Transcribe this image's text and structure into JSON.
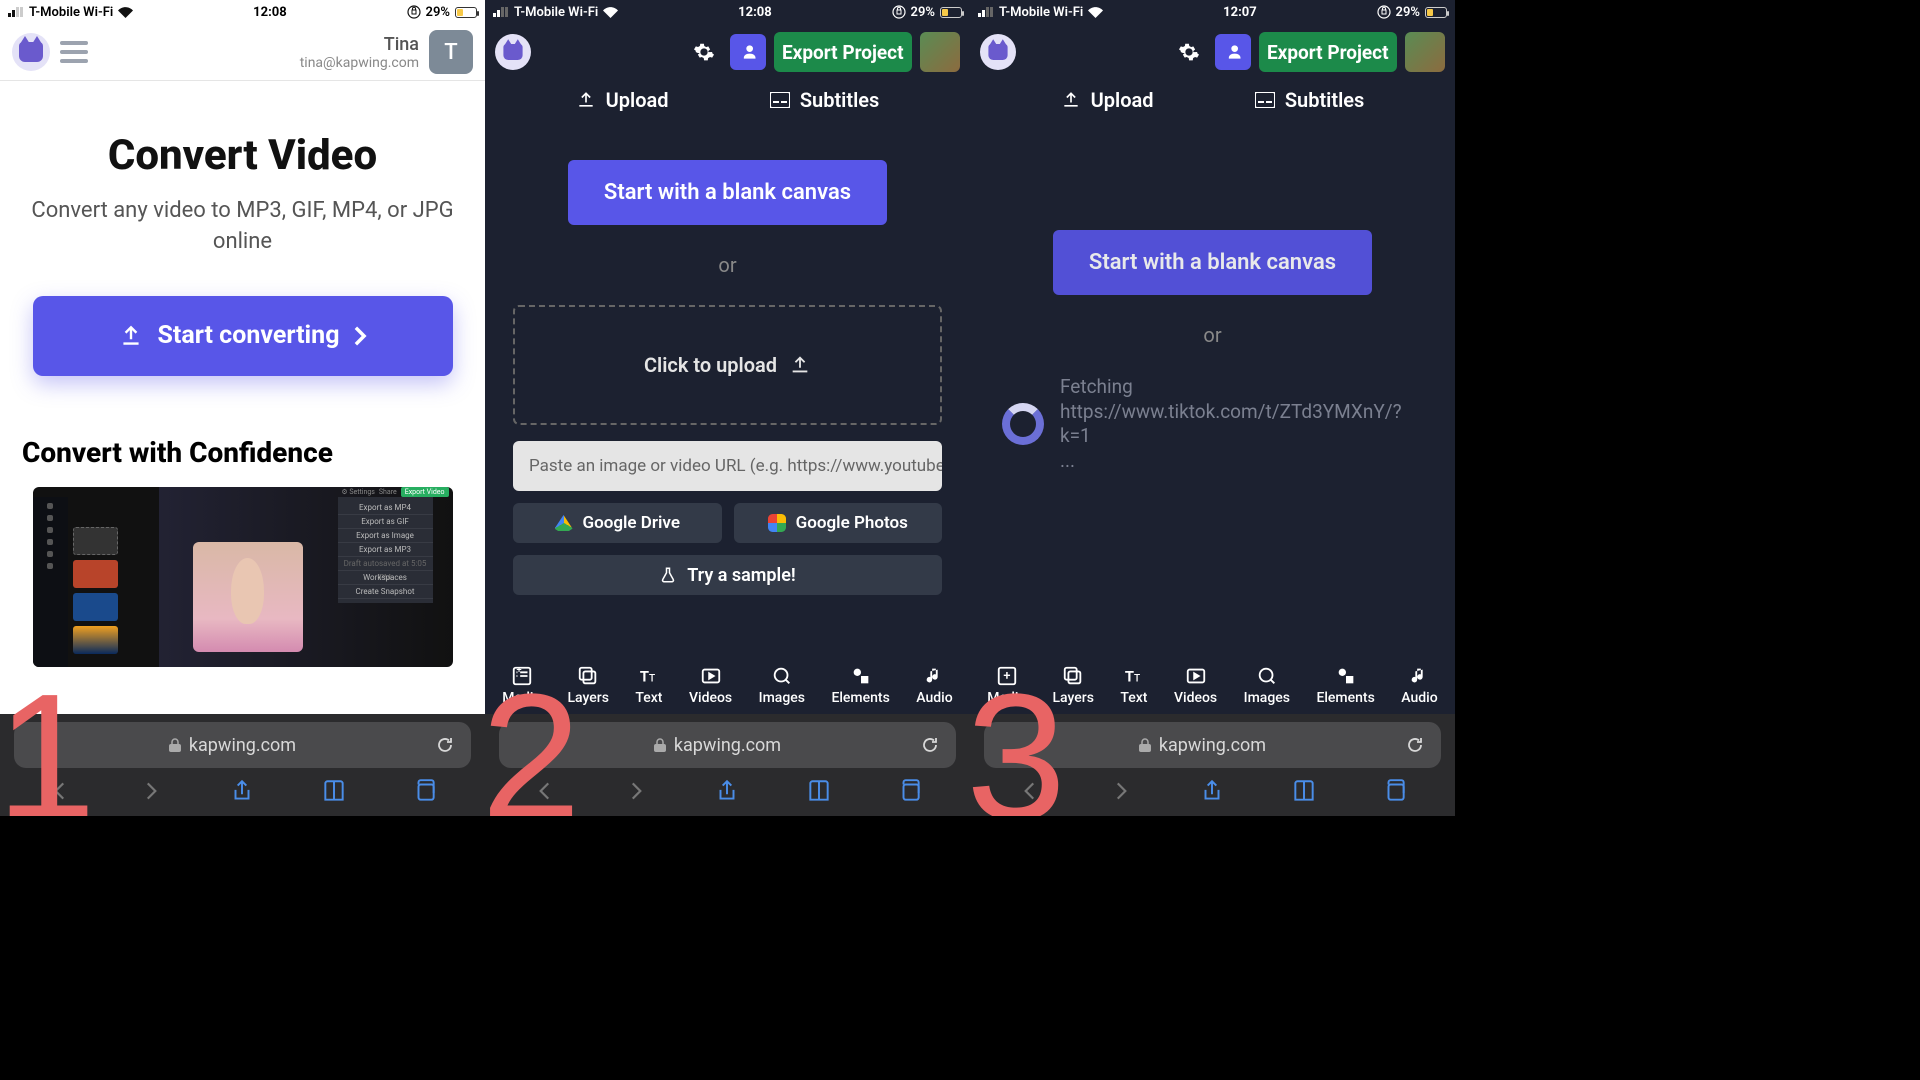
{
  "statusbar": {
    "carrier": "T-Mobile Wi-Fi",
    "time12": "12:08",
    "time3": "12:07",
    "battery": "29%"
  },
  "screen1": {
    "user_name": "Tina",
    "user_email": "tina@kapwing.com",
    "user_initial": "T",
    "h1": "Convert Video",
    "sub": "Convert any video to MP3, GIF, MP4, or JPG online",
    "cta": "Start converting",
    "h2": "Convert with Confidence",
    "demo_menu": [
      "Export as MP4",
      "Export as GIF",
      "Export as Image",
      "Export as MP3",
      "Draft autosaved at 5:05 PM",
      "Workspaces",
      "Create Snapshot"
    ],
    "demo_export": "Export Video"
  },
  "editor": {
    "export": "Export Project",
    "tab_upload": "Upload",
    "tab_subtitles": "Subtitles",
    "blank": "Start with a blank canvas",
    "or": "or",
    "click_upload": "Click to upload",
    "url_placeholder": "Paste an image or video URL (e.g. https://www.youtube.c",
    "gdrive": "Google Drive",
    "gphotos": "Google Photos",
    "sample": "Try a sample!",
    "fetching": "Fetching",
    "fetch_url": "https://www.tiktok.com/t/ZTd3YMXnY/?k=1",
    "ellipsis": "...",
    "nav": [
      "Media",
      "Layers",
      "Text",
      "Videos",
      "Images",
      "Elements",
      "Audio"
    ]
  },
  "safari": {
    "domain": "kapwing.com"
  },
  "steps": {
    "s1": "1",
    "s2": "2",
    "s3": "3"
  }
}
